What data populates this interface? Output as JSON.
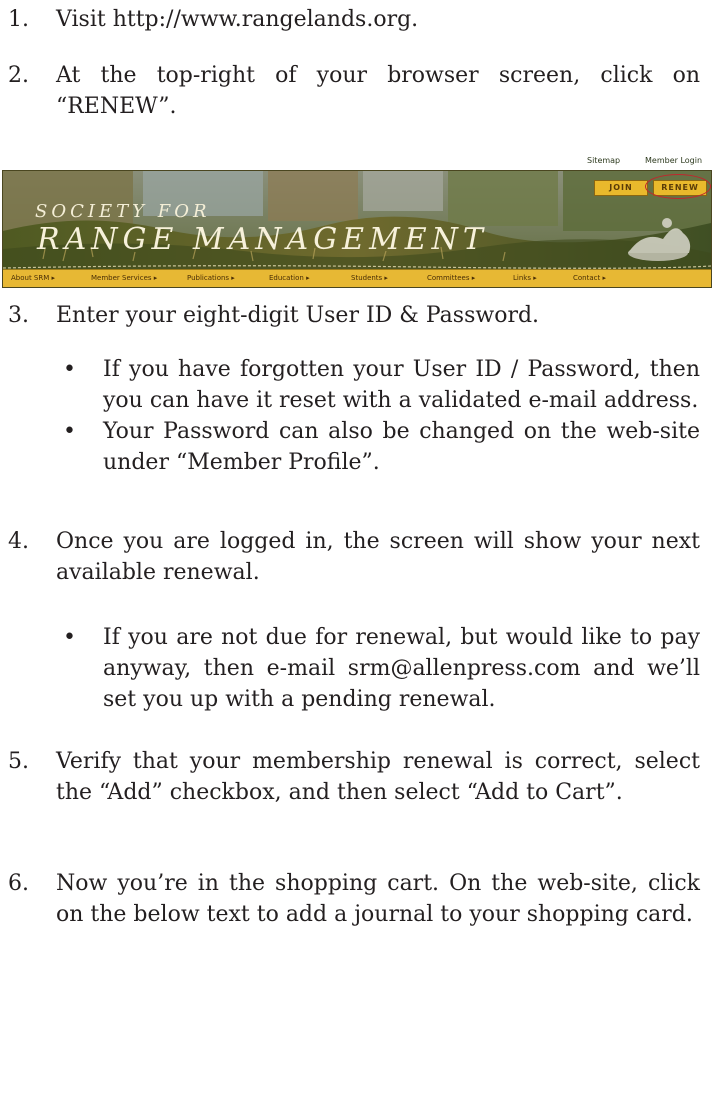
{
  "steps": [
    {
      "num": "1.",
      "text": "Visit http://www.rangelands.org."
    },
    {
      "num": "2.",
      "text": "At the top-right of your browser screen, click on “RENEW”."
    },
    {
      "num": "3.",
      "text": "Enter your eight-digit User ID & Password."
    },
    {
      "num": "4.",
      "text": "Once you are logged in, the screen will show your next available renewal."
    },
    {
      "num": "5.",
      "text": "Verify that your membership renewal is correct, select the “Add” checkbox, and then select “Add to Cart”."
    },
    {
      "num": "6.",
      "text": "Now you’re in the shopping cart. On the web-site, click on the below text to add a journal to your shopping card."
    }
  ],
  "step3_bullets": [
    "If you have forgotten your User ID / Password, then you can have it reset with a validated e-mail address.",
    "Your Password can also be changed on the web-site under “Member Profile”."
  ],
  "step4_bullets": [
    "If you are not due for renewal, but would like to pay anyway, then e-mail srm@allenpress.com and we’ll set you up with a pending renewal."
  ],
  "bullet_char": "•",
  "banner": {
    "top_links": {
      "sitemap": "Sitemap",
      "member_login": "Member Login"
    },
    "title_line1": "SOCIETY FOR",
    "title_line2": "RANGE MANAGEMENT",
    "join": "JOIN",
    "renew": "RENEW",
    "nav": [
      "About SRM ▸",
      "Member Services ▸",
      "Publications ▸",
      "Education ▸",
      "Students ▸",
      "Committees ▸",
      "Links ▸",
      "Contact ▸"
    ]
  },
  "colors": {
    "text": "#231f20",
    "nav_bar": "#e7b834",
    "renew_highlight": "#c0272d"
  }
}
